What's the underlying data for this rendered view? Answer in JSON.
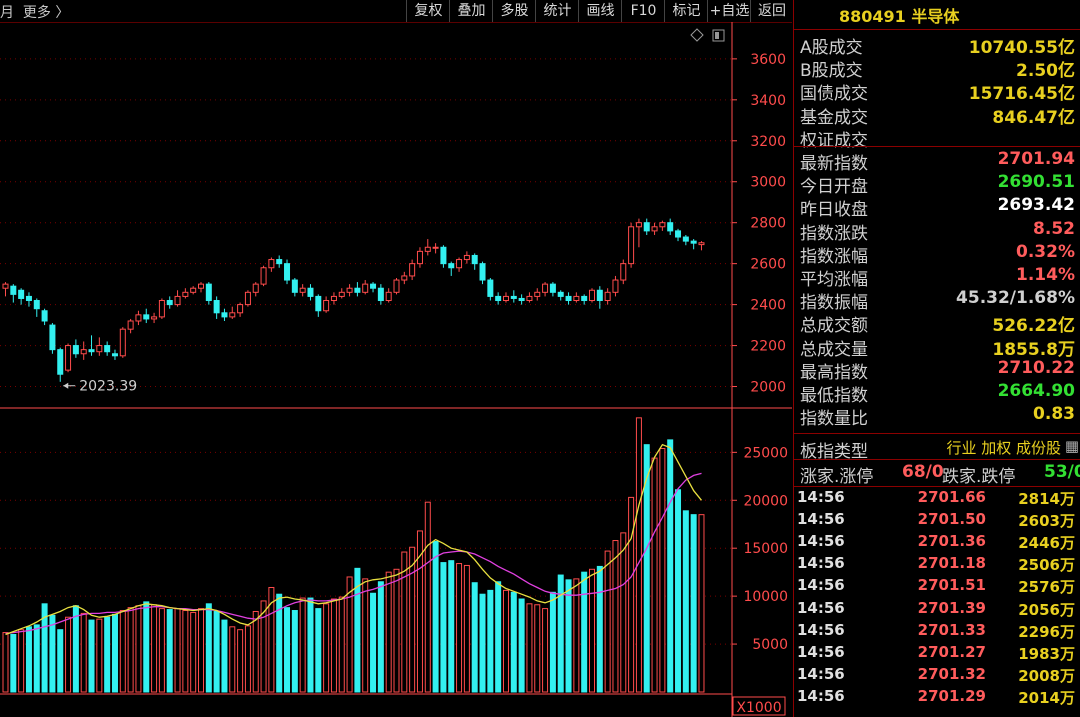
{
  "toolbar": {
    "period_label": "月  更多 〉",
    "buttons": [
      "复权",
      "叠加",
      "多股",
      "统计",
      "画线",
      "F10",
      "标记",
      "+自选",
      "返回"
    ]
  },
  "chart_data": {
    "type": "candlestick",
    "price_axis_ticks": [
      "3600",
      "3400",
      "3200",
      "3000",
      "2800",
      "2600",
      "2400",
      "2200",
      "2000"
    ],
    "price_range": [
      1900,
      3780
    ],
    "low_annotation": "2023.39",
    "volume_axis_ticks": [
      "25000",
      "20000",
      "15000",
      "10000",
      "5000"
    ],
    "volume_unit": "X1000",
    "volume_range": [
      0,
      29000
    ],
    "colors": {
      "up": "#ff4c4c",
      "down": "#33f0f0",
      "ma5": "#e8e040",
      "ma10": "#e040e0",
      "axis": "#ff4c4c"
    },
    "candles": [
      [
        2480,
        2500,
        2440,
        2510
      ],
      [
        2490,
        2450,
        2410,
        2500
      ],
      [
        2470,
        2430,
        2400,
        2480
      ],
      [
        2440,
        2420,
        2390,
        2460
      ],
      [
        2420,
        2380,
        2340,
        2430
      ],
      [
        2370,
        2320,
        2300,
        2380
      ],
      [
        2300,
        2180,
        2160,
        2310
      ],
      [
        2180,
        2060,
        2023,
        2190
      ],
      [
        2080,
        2200,
        2070,
        2210
      ],
      [
        2200,
        2160,
        2140,
        2230
      ],
      [
        2160,
        2180,
        2130,
        2220
      ],
      [
        2180,
        2170,
        2150,
        2250
      ],
      [
        2170,
        2200,
        2150,
        2240
      ],
      [
        2200,
        2170,
        2150,
        2220
      ],
      [
        2160,
        2150,
        2130,
        2180
      ],
      [
        2150,
        2280,
        2140,
        2290
      ],
      [
        2280,
        2320,
        2260,
        2330
      ],
      [
        2320,
        2350,
        2300,
        2370
      ],
      [
        2350,
        2330,
        2310,
        2380
      ],
      [
        2330,
        2340,
        2310,
        2360
      ],
      [
        2340,
        2420,
        2330,
        2430
      ],
      [
        2420,
        2400,
        2380,
        2440
      ],
      [
        2400,
        2440,
        2390,
        2470
      ],
      [
        2440,
        2460,
        2430,
        2480
      ],
      [
        2460,
        2480,
        2450,
        2490
      ],
      [
        2480,
        2500,
        2460,
        2510
      ],
      [
        2500,
        2420,
        2400,
        2510
      ],
      [
        2420,
        2360,
        2330,
        2440
      ],
      [
        2360,
        2340,
        2320,
        2380
      ],
      [
        2340,
        2360,
        2330,
        2390
      ],
      [
        2360,
        2400,
        2340,
        2410
      ],
      [
        2400,
        2460,
        2390,
        2470
      ],
      [
        2460,
        2500,
        2440,
        2510
      ],
      [
        2500,
        2580,
        2490,
        2590
      ],
      [
        2580,
        2620,
        2560,
        2630
      ],
      [
        2620,
        2600,
        2580,
        2640
      ],
      [
        2600,
        2520,
        2500,
        2620
      ],
      [
        2520,
        2460,
        2440,
        2530
      ],
      [
        2460,
        2480,
        2440,
        2500
      ],
      [
        2480,
        2440,
        2420,
        2500
      ],
      [
        2440,
        2370,
        2340,
        2450
      ],
      [
        2370,
        2420,
        2360,
        2440
      ],
      [
        2420,
        2440,
        2400,
        2460
      ],
      [
        2440,
        2460,
        2430,
        2480
      ],
      [
        2460,
        2480,
        2440,
        2500
      ],
      [
        2480,
        2460,
        2440,
        2510
      ],
      [
        2460,
        2500,
        2450,
        2520
      ],
      [
        2500,
        2480,
        2460,
        2510
      ],
      [
        2480,
        2420,
        2400,
        2500
      ],
      [
        2420,
        2460,
        2410,
        2480
      ],
      [
        2460,
        2520,
        2450,
        2530
      ],
      [
        2520,
        2540,
        2500,
        2560
      ],
      [
        2540,
        2600,
        2520,
        2620
      ],
      [
        2600,
        2660,
        2580,
        2680
      ],
      [
        2660,
        2680,
        2640,
        2720
      ],
      [
        2680,
        2680,
        2650,
        2700
      ],
      [
        2680,
        2600,
        2580,
        2690
      ],
      [
        2600,
        2580,
        2540,
        2610
      ],
      [
        2580,
        2620,
        2560,
        2630
      ],
      [
        2620,
        2640,
        2600,
        2660
      ],
      [
        2640,
        2600,
        2570,
        2650
      ],
      [
        2600,
        2520,
        2500,
        2610
      ],
      [
        2520,
        2440,
        2420,
        2530
      ],
      [
        2440,
        2420,
        2400,
        2460
      ],
      [
        2420,
        2440,
        2410,
        2460
      ],
      [
        2440,
        2430,
        2410,
        2470
      ],
      [
        2430,
        2420,
        2400,
        2450
      ],
      [
        2420,
        2440,
        2410,
        2460
      ],
      [
        2440,
        2460,
        2420,
        2480
      ],
      [
        2460,
        2500,
        2440,
        2510
      ],
      [
        2500,
        2460,
        2440,
        2510
      ],
      [
        2460,
        2440,
        2420,
        2470
      ],
      [
        2440,
        2420,
        2400,
        2460
      ],
      [
        2420,
        2440,
        2410,
        2460
      ],
      [
        2440,
        2420,
        2400,
        2450
      ],
      [
        2420,
        2470,
        2410,
        2480
      ],
      [
        2470,
        2420,
        2380,
        2490
      ],
      [
        2420,
        2460,
        2400,
        2480
      ],
      [
        2460,
        2520,
        2440,
        2540
      ],
      [
        2520,
        2600,
        2500,
        2620
      ],
      [
        2600,
        2780,
        2580,
        2800
      ],
      [
        2780,
        2800,
        2680,
        2820
      ],
      [
        2800,
        2760,
        2740,
        2820
      ],
      [
        2760,
        2780,
        2740,
        2800
      ],
      [
        2780,
        2800,
        2760,
        2810
      ],
      [
        2800,
        2760,
        2740,
        2820
      ],
      [
        2760,
        2730,
        2710,
        2770
      ],
      [
        2730,
        2710,
        2690,
        2740
      ],
      [
        2710,
        2700,
        2670,
        2720
      ],
      [
        2693,
        2702,
        2665,
        2710
      ]
    ],
    "volumes": [
      6200,
      6000,
      6500,
      6800,
      7000,
      9200,
      8000,
      6500,
      7800,
      9000,
      8200,
      7500,
      7600,
      7800,
      8100,
      8500,
      8800,
      9000,
      9400,
      9100,
      8700,
      8600,
      8700,
      8500,
      8300,
      8700,
      9200,
      8400,
      7500,
      6800,
      6500,
      6900,
      8400,
      9500,
      10900,
      10200,
      8800,
      8500,
      9800,
      9800,
      8700,
      9200,
      9700,
      9900,
      12000,
      12900,
      11800,
      10300,
      11500,
      12500,
      12800,
      14600,
      15100,
      16800,
      19800,
      15700,
      13500,
      13700,
      13400,
      13200,
      11400,
      10200,
      10600,
      11500,
      10600,
      10400,
      9700,
      9200,
      9100,
      8700,
      10400,
      12200,
      11700,
      11800,
      12500,
      12800,
      13100,
      14700,
      15800,
      16600,
      20300,
      28600,
      25800,
      24400,
      25400,
      26300,
      21100,
      18900,
      18500,
      18500
    ],
    "volume_up": [
      1,
      0,
      1,
      0,
      0,
      0,
      0,
      0,
      1,
      0,
      1,
      0,
      1,
      0,
      0,
      1,
      1,
      1,
      0,
      1,
      1,
      0,
      1,
      1,
      1,
      1,
      0,
      0,
      0,
      1,
      1,
      1,
      1,
      1,
      1,
      0,
      0,
      0,
      1,
      0,
      0,
      1,
      1,
      1,
      1,
      0,
      1,
      0,
      0,
      1,
      1,
      1,
      1,
      1,
      1,
      0,
      0,
      0,
      1,
      1,
      0,
      0,
      0,
      0,
      1,
      0,
      0,
      1,
      1,
      1,
      0,
      0,
      0,
      1,
      0,
      1,
      0,
      1,
      1,
      1,
      1,
      1,
      0,
      1,
      1,
      0,
      0,
      0,
      0,
      1
    ],
    "ma5": [
      6000,
      6300,
      6600,
      6900,
      7300,
      7800,
      8100,
      8400,
      8800,
      9000,
      8600,
      8000,
      7800,
      7900,
      8100,
      8400,
      8700,
      9000,
      9200,
      9100,
      9000,
      8800,
      8700,
      8600,
      8500,
      8600,
      8700,
      8500,
      8100,
      7600,
      7200,
      7000,
      7500,
      8300,
      9300,
      9800,
      9900,
      9700,
      9600,
      9400,
      9200,
      9300,
      9500,
      9700,
      10400,
      11000,
      11500,
      11700,
      11800,
      12000,
      12200,
      12600,
      13200,
      14200,
      15300,
      15900,
      15500,
      15000,
      14800,
      14600,
      13800,
      12800,
      11900,
      11300,
      10800,
      10500,
      10200,
      9900,
      9500,
      9300,
      9600,
      10100,
      10600,
      11100,
      11700,
      12200,
      12600,
      13300,
      14000,
      14800,
      16000,
      19500,
      22300,
      24500,
      25800,
      25500,
      24000,
      22500,
      21000,
      20000
    ],
    "ma10": [
      6100,
      6200,
      6300,
      6400,
      6600,
      6800,
      7000,
      7300,
      7600,
      7900,
      8100,
      8200,
      8200,
      8300,
      8300,
      8400,
      8500,
      8700,
      8800,
      8900,
      8900,
      8800,
      8700,
      8700,
      8600,
      8600,
      8600,
      8500,
      8300,
      8100,
      7900,
      7700,
      7600,
      7800,
      8200,
      8600,
      9000,
      9300,
      9500,
      9600,
      9500,
      9500,
      9600,
      9700,
      9900,
      10200,
      10500,
      10700,
      11000,
      11300,
      11600,
      12000,
      12400,
      12900,
      13500,
      14100,
      14500,
      14600,
      14700,
      14600,
      14400,
      14000,
      13600,
      13100,
      12700,
      12300,
      11800,
      11300,
      10900,
      10500,
      10300,
      10200,
      10100,
      10100,
      10200,
      10300,
      10400,
      10600,
      10800,
      11200,
      12000,
      13500,
      15000,
      16700,
      18200,
      19800,
      21200,
      22100,
      22600,
      22800
    ]
  },
  "panel": {
    "title": "880491 半导体",
    "stats": [
      {
        "label": "A股成交",
        "value": "10740.55亿",
        "color": "#e8d020"
      },
      {
        "label": "B股成交",
        "value": "2.50亿",
        "color": "#e8d020"
      },
      {
        "label": "国债成交",
        "value": "15716.45亿",
        "color": "#e8d020"
      },
      {
        "label": "基金成交",
        "value": "846.47亿",
        "color": "#e8d020"
      },
      {
        "label": "权证成交",
        "value": "",
        "color": "#e8d020"
      },
      {
        "label": "最新指数",
        "value": "2701.94",
        "color": "#ff5c5c"
      },
      {
        "label": "今日开盘",
        "value": "2690.51",
        "color": "#33e033"
      },
      {
        "label": "昨日收盘",
        "value": "2693.42",
        "color": "#ffffff"
      },
      {
        "label": "指数涨跌",
        "value": "8.52",
        "color": "#ff5c5c"
      },
      {
        "label": "指数涨幅",
        "value": "0.32%",
        "color": "#ff5c5c"
      },
      {
        "label": "平均涨幅",
        "value": "1.14%",
        "color": "#ff5c5c"
      },
      {
        "label": "指数振幅",
        "value": "45.32/1.68%",
        "color": "#d0d0d0"
      },
      {
        "label": "总成交额",
        "value": "526.22亿",
        "color": "#e8d020"
      },
      {
        "label": "总成交量",
        "value": "1855.8万",
        "color": "#e8d020"
      },
      {
        "label": "最高指数",
        "value": "2710.22",
        "color": "#ff5c5c"
      },
      {
        "label": "最低指数",
        "value": "2664.90",
        "color": "#33e033"
      },
      {
        "label": "指数量比",
        "value": "0.83",
        "color": "#e8d020"
      }
    ],
    "type_label": "板指类型",
    "type_value": "行业 加权 成份股",
    "breadth": {
      "up_label": "涨家.涨停",
      "up_value": "68/0",
      "down_label": "跌家.跌停",
      "down_value": "53/0"
    },
    "ticks": [
      {
        "time": "14:56",
        "price": "2701.66",
        "vol": "2814万"
      },
      {
        "time": "14:56",
        "price": "2701.50",
        "vol": "2603万"
      },
      {
        "time": "14:56",
        "price": "2701.36",
        "vol": "2446万"
      },
      {
        "time": "14:56",
        "price": "2701.18",
        "vol": "2506万"
      },
      {
        "time": "14:56",
        "price": "2701.51",
        "vol": "2576万"
      },
      {
        "time": "14:56",
        "price": "2701.39",
        "vol": "2056万"
      },
      {
        "time": "14:56",
        "price": "2701.33",
        "vol": "2296万"
      },
      {
        "time": "14:56",
        "price": "2701.27",
        "vol": "1983万"
      },
      {
        "time": "14:56",
        "price": "2701.32",
        "vol": "2008万"
      },
      {
        "time": "14:56",
        "price": "2701.29",
        "vol": "2014万"
      }
    ]
  }
}
